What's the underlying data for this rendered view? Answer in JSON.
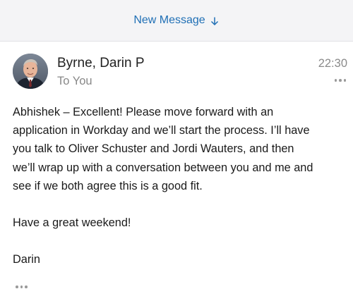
{
  "header": {
    "new_message_label": "New Message",
    "arrow_icon": "arrow-down-icon",
    "accent_color": "#1f6fb5"
  },
  "message": {
    "sender": "Byrne, Darin P",
    "recipient": "To You",
    "time": "22:30",
    "more_icon": "ellipsis-icon",
    "body": {
      "p1_line1": "Abhishek – Excellent!  Please move forward with an",
      "p1_line2": "application in Workday and we’ll start the process.  I’ll have",
      "p1_line3": "you talk to Oliver Schuster and Jordi Wauters, and then",
      "p1_line4": "we’ll wrap up with a conversation between you and me and",
      "p1_line5": "see if we both agree this is a good fit.",
      "p2": "Have a great weekend!",
      "signature": "Darin"
    }
  }
}
